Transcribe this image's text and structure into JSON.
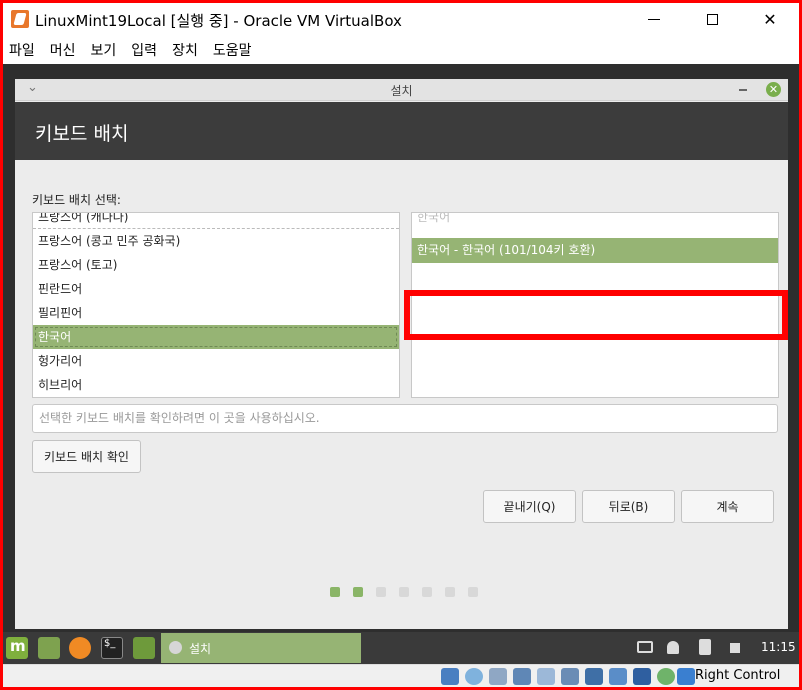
{
  "host_window": {
    "title": "LinuxMint19Local [실행 중] - Oracle VM VirtualBox",
    "icon": "virtualbox-icon",
    "controls": {
      "minimize": "—",
      "maximize": "☐",
      "close": "✕"
    }
  },
  "menubar": {
    "items": [
      "파일",
      "머신",
      "보기",
      "입력",
      "장치",
      "도움말"
    ]
  },
  "installer": {
    "window_title": "설치",
    "header_title": "키보드 배치",
    "section_label": "키보드 배치 선택:",
    "layouts": [
      "프랑스어 (캐나다)",
      "프랑스어 (콩고 민주 공화국)",
      "프랑스어 (토고)",
      "핀란드어",
      "필리핀어",
      "한국어",
      "헝가리어",
      "히브리어"
    ],
    "selected_layout": "한국어",
    "variants": [
      "한국어",
      "한국어 - 한국어 (101/104키 호환)"
    ],
    "selected_variant": "한국어 - 한국어 (101/104키 호환)",
    "test_input_placeholder": "선택한 키보드 배치를 확인하려면 이 곳을 사용하십시오.",
    "detect_button": "키보드 배치 확인",
    "quit_button": "끝내기(Q)",
    "back_button": "뒤로(B)",
    "continue_button": "계속",
    "progress": {
      "total_steps": 7,
      "current_step": 2
    }
  },
  "taskbar": {
    "task_label": "설치",
    "clock": "11:15"
  },
  "statusbar": {
    "host_key": "Right Control"
  },
  "colors": {
    "accent": "#96b474",
    "header_bg": "#3c3c3c",
    "annotation": "#ff0000"
  }
}
